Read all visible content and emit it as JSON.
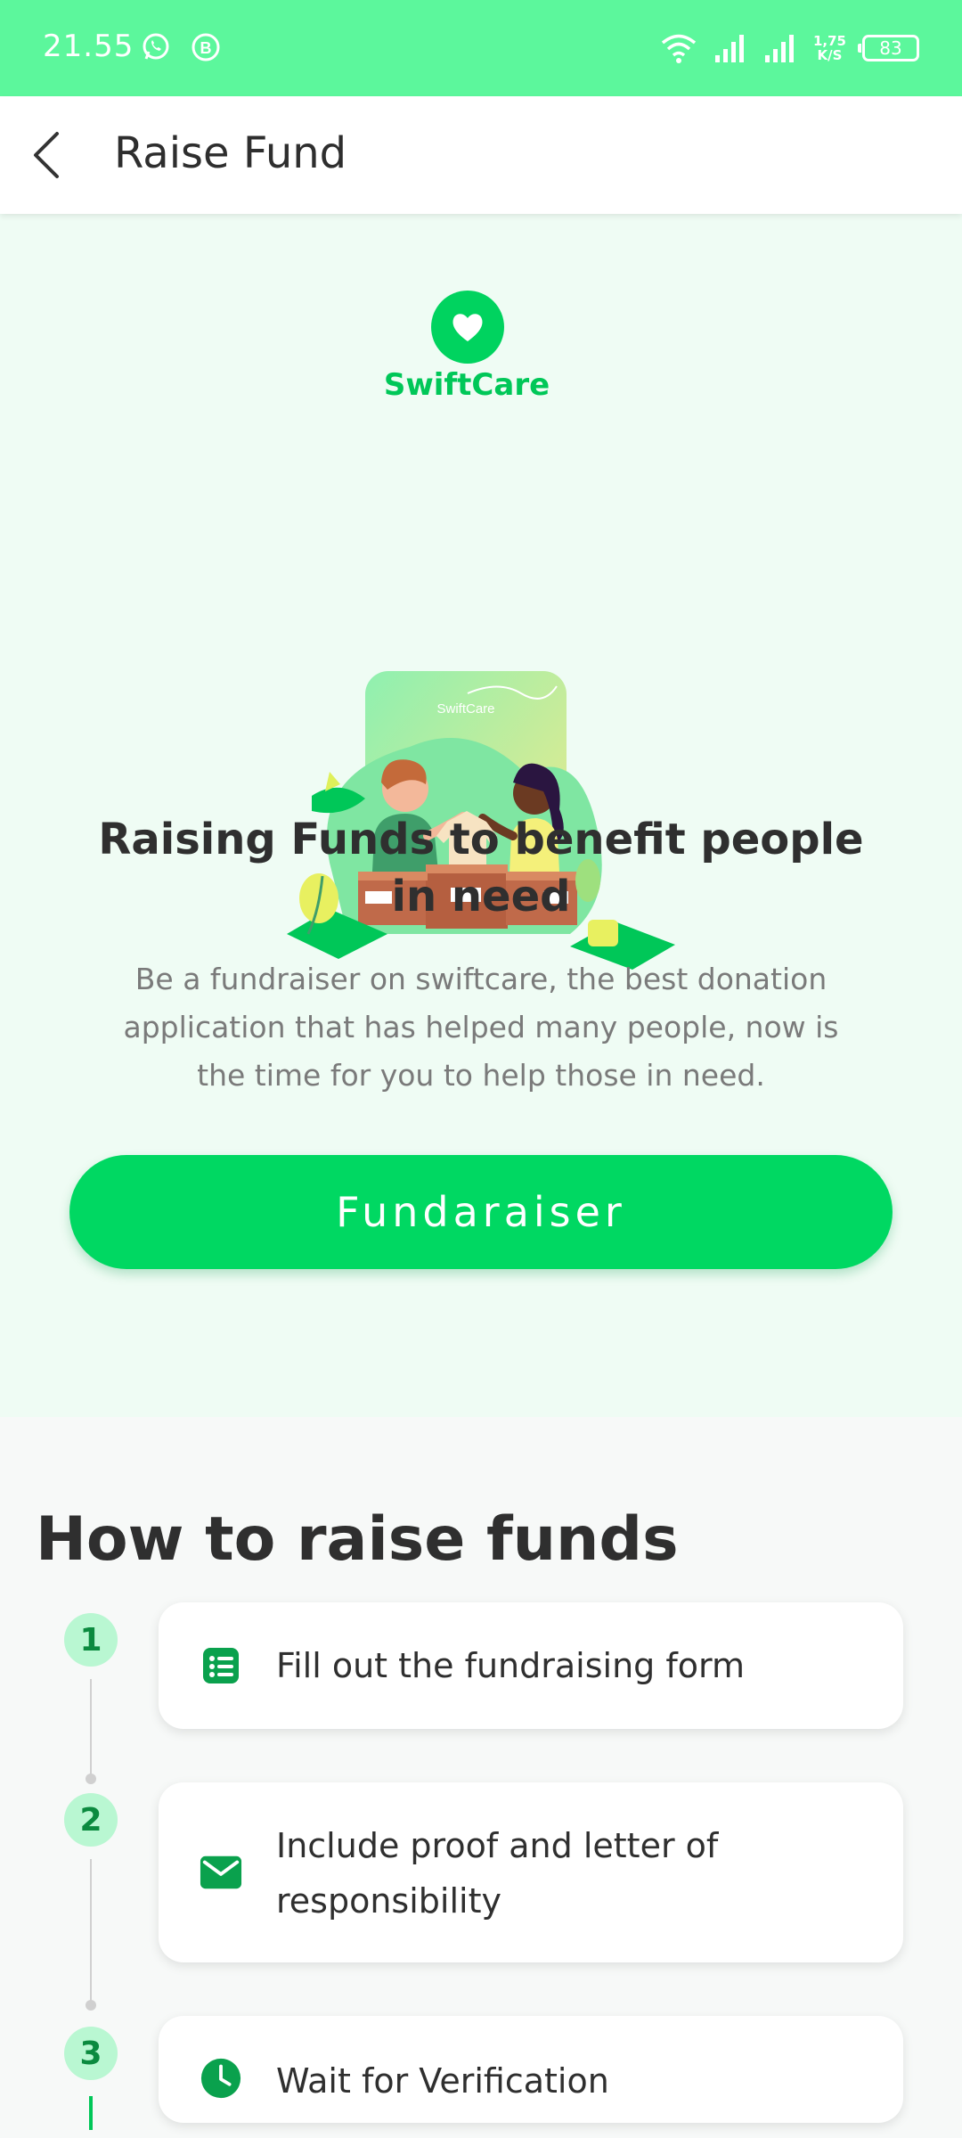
{
  "status_bar": {
    "time": "21.55",
    "network_speed_value": "1,75",
    "network_speed_unit": "K/S",
    "battery": "83"
  },
  "app_bar": {
    "title": "Raise Fund"
  },
  "hero": {
    "brand": "SwiftCare",
    "illustration_sign": "SwiftCare",
    "heading": "Raising Funds to benefit people in need",
    "description": "Be a fundraiser on swiftcare, the best donation application that has helped many people, now is the time for you to help those in need.",
    "cta_label": "Fundaraiser"
  },
  "how_to": {
    "title": "How to raise funds",
    "steps": [
      {
        "number": "1",
        "label": "Fill out the fundraising form",
        "icon": "form-list-icon"
      },
      {
        "number": "2",
        "label": "Include proof and letter of responsibility",
        "icon": "envelope-icon"
      },
      {
        "number": "3",
        "label": "Wait for Verification",
        "icon": "clock-icon"
      }
    ]
  },
  "colors": {
    "status_bar": "#5cf79c",
    "accent": "#00d862",
    "hero_background": "#effcf4",
    "step_badge": "#b9f7d2"
  }
}
